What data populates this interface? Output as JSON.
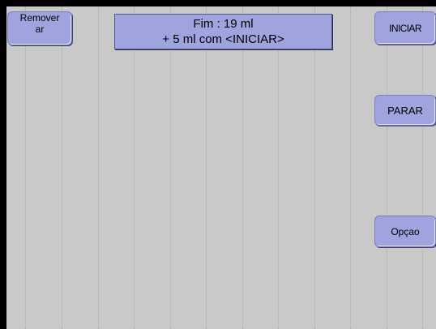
{
  "buttons": {
    "remover_line1": "Remover",
    "remover_line2": "ar",
    "iniciar": "INICIAR",
    "parar": "PARAR",
    "opcao": "Opçao"
  },
  "status": {
    "line1": "Fim :  19 ml",
    "line2": "+ 5 ml com <INICIAR>"
  },
  "colors": {
    "button_fill": "#9fa3de",
    "background": "#c9c9c9",
    "frame": "#000000"
  }
}
